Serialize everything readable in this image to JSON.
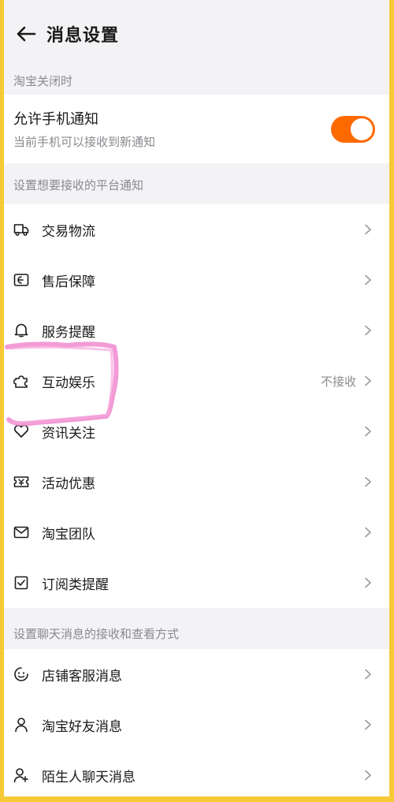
{
  "header": {
    "title": "消息设置"
  },
  "closed_section": {
    "label": "淘宝关闭时",
    "notify_title": "允许手机通知",
    "notify_subtitle": "当前手机可以接收到新通知",
    "toggle_on": true,
    "accent_color": "#ff6a00"
  },
  "platform_section": {
    "label": "设置想要接收的平台通知",
    "items": [
      {
        "label": "交易物流",
        "icon": "truck-icon",
        "status": ""
      },
      {
        "label": "售后保障",
        "icon": "shield-ticket-icon",
        "status": ""
      },
      {
        "label": "服务提醒",
        "icon": "bell-icon",
        "status": ""
      },
      {
        "label": "互动娱乐",
        "icon": "puzzle-icon",
        "status": "不接收"
      },
      {
        "label": "资讯关注",
        "icon": "heart-icon",
        "status": ""
      },
      {
        "label": "活动优惠",
        "icon": "coupon-icon",
        "status": ""
      },
      {
        "label": "淘宝团队",
        "icon": "mail-icon",
        "status": ""
      },
      {
        "label": "订阅类提醒",
        "icon": "checkbox-icon",
        "status": ""
      }
    ]
  },
  "chat_section": {
    "label": "设置聊天消息的接收和查看方式",
    "items": [
      {
        "label": "店铺客服消息",
        "icon": "smiley-icon"
      },
      {
        "label": "淘宝好友消息",
        "icon": "person-icon"
      },
      {
        "label": "陌生人聊天消息",
        "icon": "person-plus-icon"
      }
    ]
  }
}
